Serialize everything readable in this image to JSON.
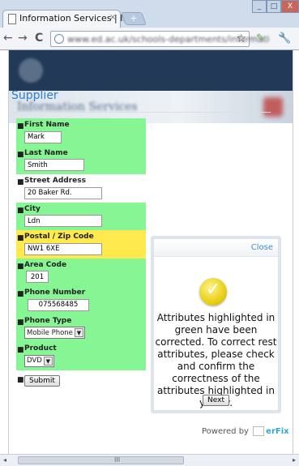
{
  "browser": {
    "tab_title": "Information Services | I...",
    "tab_close": "×",
    "new_tab": "+",
    "url": "www.ed.ac.uk/schools-departments/informati",
    "nav_back": "←",
    "nav_forward": "→",
    "nav_reload": "C",
    "star": "☆",
    "win_min": "_",
    "win_max": "□",
    "win_close": "X"
  },
  "site": {
    "name": "Information Services"
  },
  "page": {
    "title": "Supplier"
  },
  "form": {
    "fields": [
      {
        "label": "First Name",
        "value": "Mark",
        "status": "green"
      },
      {
        "label": "Last Name",
        "value": "Smith",
        "status": "green"
      },
      {
        "label": "Street Address",
        "value": "20 Baker Rd.",
        "status": "none"
      },
      {
        "label": "City",
        "value": "Ldn",
        "status": "green"
      },
      {
        "label": "Postal / Zip Code",
        "value": "NW1 6XE",
        "status": "yellow"
      },
      {
        "label": "Area Code",
        "value": "201",
        "status": "green"
      },
      {
        "label": "Phone Number",
        "value": "075568485",
        "status": "green"
      },
      {
        "label": "Phone Type",
        "value": "Mobile Phone",
        "status": "green"
      },
      {
        "label": "Product",
        "value": "DVD",
        "status": "green"
      }
    ],
    "submit_label": "Submit"
  },
  "dialog": {
    "close_label": "Close",
    "message": "Attributes highlighted in green have been corrected. To correct rest attributes, please check and confirm the correctness of the attributes highlighted in yellow.",
    "next_label": "Next"
  },
  "footer": {
    "powered_by": "Powered by",
    "logo_text": "erFix"
  },
  "scrollbar": {
    "left_arrow": "◂",
    "right_arrow": "▸",
    "grip": "III"
  },
  "colors": {
    "corrected": "#86f593",
    "needs_check": "#ffe94d",
    "link": "#2b7fc6"
  }
}
